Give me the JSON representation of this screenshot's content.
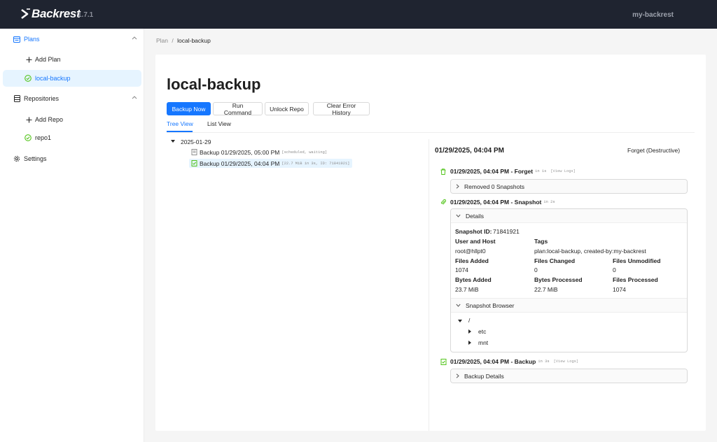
{
  "header": {
    "logo_text": "Backrest",
    "version": "1.7.1",
    "instance_name": "my-backrest"
  },
  "sidebar": {
    "plans_label": "Plans",
    "add_plan_label": "Add Plan",
    "plan_item_label": "local-backup",
    "repositories_label": "Repositories",
    "add_repo_label": "Add Repo",
    "repo_item_label": "repo1",
    "settings_label": "Settings"
  },
  "breadcrumb": {
    "root": "Plan",
    "separator": "/",
    "current": "local-backup"
  },
  "page": {
    "title": "local-backup",
    "buttons": {
      "backup_now": "Backup Now",
      "run_command": "Run Command",
      "unlock_repo": "Unlock Repo",
      "clear_error_history": "Clear Error History"
    },
    "tabs": [
      "Tree View",
      "List View"
    ]
  },
  "tree": {
    "date": "2025-01-29",
    "items": [
      {
        "label": "Backup 01/29/2025, 05:00 PM",
        "meta": "[scheduled, waiting]"
      },
      {
        "label": "Backup 01/29/2025, 04:04 PM",
        "meta": "[22.7 MiB in 3s, ID: 71841921]"
      }
    ]
  },
  "detail": {
    "title": "01/29/2025, 04:04 PM",
    "forget_label": "Forget (Destructive)",
    "forget_event": {
      "title": "01/29/2025, 04:04 PM - Forget",
      "duration": "in 1s",
      "link": "[View Logs]"
    },
    "removed_label": "Removed 0 Snapshots",
    "snapshot_event": {
      "title": "01/29/2025, 04:04 PM - Snapshot",
      "duration": "in 2s"
    },
    "details_label": "Details",
    "snapshot_id_label": "Snapshot ID:",
    "snapshot_id": "71841921",
    "user_host_label": "User and Host",
    "user_host": "root@hllpt0",
    "tags_label": "Tags",
    "tags": "plan:local-backup, created-by:my-backrest",
    "files_added_label": "Files Added",
    "files_added": "1074",
    "files_changed_label": "Files Changed",
    "files_changed": "0",
    "files_unmodified_label": "Files Unmodified",
    "files_unmodified": "0",
    "bytes_added_label": "Bytes Added",
    "bytes_added": "23.7 MiB",
    "bytes_processed_label": "Bytes Processed",
    "bytes_processed": "22.7 MiB",
    "files_processed_label": "Files Processed",
    "files_processed": "1074",
    "snapshot_browser_label": "Snapshot Browser",
    "fs_root": "/",
    "fs_children": [
      "etc",
      "mnt"
    ],
    "backup_event": {
      "title": "01/29/2025, 04:04 PM - Backup",
      "duration": "in 3s",
      "link": "[View Logs]"
    },
    "backup_details_label": "Backup Details"
  },
  "colors": {
    "accent": "#1677ff",
    "header_bg": "#1f2430",
    "success": "#52c41a"
  }
}
